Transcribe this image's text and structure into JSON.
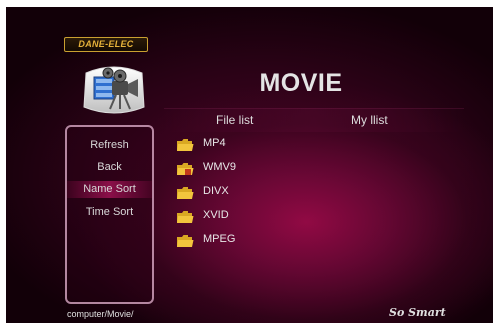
{
  "brand": "DANE-ELEC",
  "title": "MOVIE",
  "tabs": [
    {
      "label": "File list"
    },
    {
      "label": "My llist"
    }
  ],
  "menu": {
    "items": [
      {
        "label": "Refresh"
      },
      {
        "label": "Back"
      },
      {
        "label": "Name Sort"
      },
      {
        "label": "Time Sort"
      }
    ],
    "selected_index": 2
  },
  "files": [
    {
      "name": "MP4",
      "icon": "folder-icon"
    },
    {
      "name": "WMV9",
      "icon": "locked-folder-icon"
    },
    {
      "name": "DIVX",
      "icon": "folder-icon"
    },
    {
      "name": "XVID",
      "icon": "folder-icon"
    },
    {
      "name": "MPEG",
      "icon": "folder-icon"
    }
  ],
  "path": "computer/Movie/",
  "tagline": "So Smart",
  "colors": {
    "background": "#2a0216",
    "highlight": "#aa145a",
    "brand": "#e6b23a",
    "folder": "#f2c53d"
  }
}
